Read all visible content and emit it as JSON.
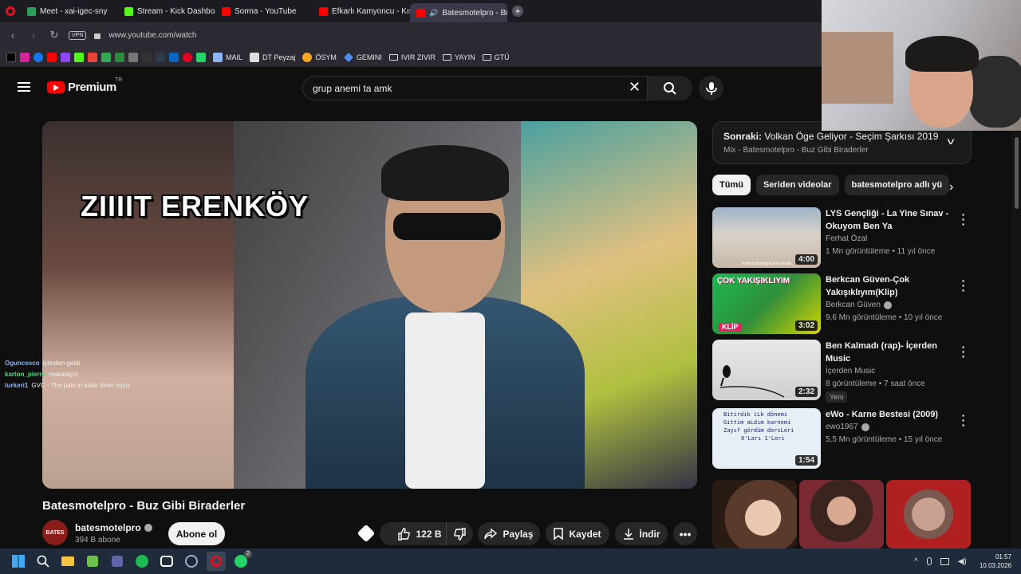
{
  "browser": {
    "tabs": [
      {
        "label": "Meet - xai-igec-sny",
        "color": "#2a9d5c"
      },
      {
        "label": "Stream - Kick Dashboard",
        "color": "#53fc18"
      },
      {
        "label": "Sorma - YouTube",
        "color": "#ff0000"
      },
      {
        "label": "Efkarlı Kamyoncu - Kış Ma",
        "color": "#ff0000"
      },
      {
        "label": "Batesmotelpro - Buz G",
        "color": "#ff0000"
      }
    ],
    "vpn_label": "VPN",
    "url": "www.youtube.com/watch",
    "bookmarks": [
      {
        "label": "MAIL",
        "icon": "mail-icon"
      },
      {
        "label": "DT Peyzaj",
        "icon": "dt-icon"
      },
      {
        "label": "ÖSYM",
        "icon": "osym-icon"
      },
      {
        "label": "GEMINI",
        "icon": "gemini-icon"
      },
      {
        "label": "IVIR ZIVIR",
        "icon": "folder-icon"
      },
      {
        "label": "YAYIN",
        "icon": "folder-icon"
      },
      {
        "label": "GTÜ",
        "icon": "folder-icon"
      }
    ]
  },
  "youtube": {
    "brand": "Premium",
    "region": "TR",
    "search_query": "grup anemi ta amk"
  },
  "player": {
    "overlay_text": "ZIIIIT ERENKÖY",
    "chat": [
      {
        "user": "Oguncesco",
        "message": "içimden geldi",
        "color": "#8ab4f8"
      },
      {
        "user": "karton_pierre",
        "message": "makarayız",
        "color": "#4ade80"
      },
      {
        "user": "turkeri1",
        "message": "GVC - The pain in kabir diner miyiz",
        "color": "#8ab4f8"
      }
    ]
  },
  "video": {
    "title": "Batesmotelpro - Buz Gibi Biraderler",
    "channel": "batesmotelpro",
    "avatar_text": "BATES",
    "subscribers": "394 B abone",
    "subscribe_label": "Abone ol",
    "likes": "122 B",
    "share_label": "Paylaş",
    "save_label": "Kaydet",
    "download_label": "İndir"
  },
  "up_next": {
    "prefix": "Sonraki:",
    "title": "Volkan Öge Geliyor - Seçim Şarkısı 2019",
    "subtitle": "Mix - Batesmotelpro - Buz Gibi Biraderler"
  },
  "chips": [
    "Tümü",
    "Seriden videolar",
    "batesmotelpro adlı yü"
  ],
  "recommendations": [
    {
      "title": "LYS Gençliği - La Yine Sınav - Okuyom Ben Ya",
      "channel": "Ferhat Özal",
      "verified": false,
      "meta": "1 Mn görüntüleme • 11 yıl önce",
      "duration": "4:00",
      "thumb_caption": "Kitreya Biyoloji bunlar bizde",
      "badge": ""
    },
    {
      "title": "Berkcan Güven-Çok Yakışıklıyım(Klip)",
      "channel": "Berkcan Güven",
      "verified": true,
      "meta": "9,6 Mn görüntüleme • 10 yıl önce",
      "duration": "3:02",
      "thumb_caption": "ÇOK YAKIŞIKLIYIM",
      "thumb_tag": "KLİP",
      "badge": ""
    },
    {
      "title": "Ben Kalmadı (rap)- İçerden Music",
      "channel": "İçerden Music",
      "verified": false,
      "meta": "8 görüntüleme • 7 saat önce",
      "duration": "2:32",
      "badge": "Yeni"
    },
    {
      "title": "eWo - Karne Bestesi (2009)",
      "channel": "ewo1967",
      "verified": true,
      "meta": "5,5 Mn görüntüleme • 15 yıl önce",
      "duration": "1:54",
      "thumb_lines": [
        "Bitirdik iLk dönemi",
        "Gittim aLdım karnemi",
        "Zayıf gördüm dersLeri",
        "0'Ları 1'Leri"
      ],
      "badge": ""
    }
  ],
  "taskbar": {
    "time": "01:57",
    "date": "10.03.2026",
    "whatsapp_badge": "2"
  }
}
